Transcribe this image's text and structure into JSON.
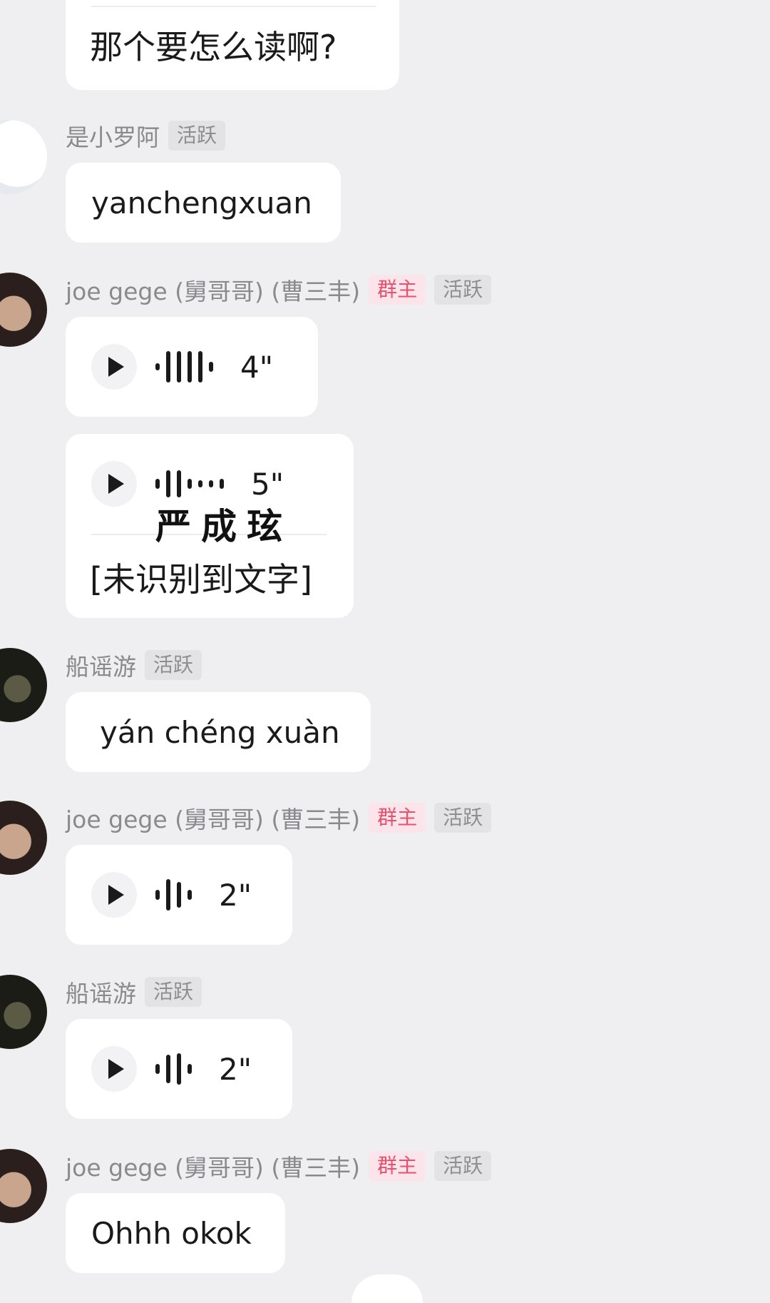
{
  "messages": [
    {
      "text": "那个要怎么读啊?"
    },
    {
      "sender": "是小罗阿",
      "tags": [
        "活跃"
      ],
      "text": "yanchengxuan"
    },
    {
      "sender": "joe gege (舅哥哥) (曹三丰)",
      "tags": [
        "群主",
        "活跃"
      ],
      "voice_duration": "4\""
    },
    {
      "voice_duration": "5\"",
      "caption": "严成玹",
      "transcript": "[未识别到文字]"
    },
    {
      "sender": "船谣游",
      "tags": [
        "活跃"
      ],
      "text": "yán chéng xuàn"
    },
    {
      "sender": "joe gege (舅哥哥) (曹三丰)",
      "tags": [
        "群主",
        "活跃"
      ],
      "voice_duration": "2\""
    },
    {
      "sender": "船谣游",
      "tags": [
        "活跃"
      ],
      "voice_duration": "2\""
    },
    {
      "sender": "joe gege (舅哥哥) (曹三丰)",
      "tags": [
        "群主",
        "活跃"
      ],
      "text": "Ohhh okok"
    }
  ],
  "colors": {
    "background": "#efeff1",
    "bubble": "#ffffff",
    "owner_tag_text": "#e8506e",
    "owner_tag_bg": "#fbe5ea",
    "active_tag_bg": "#e3e3e6"
  },
  "icons": {
    "play": "play-icon",
    "waveform": "waveform-icon"
  }
}
